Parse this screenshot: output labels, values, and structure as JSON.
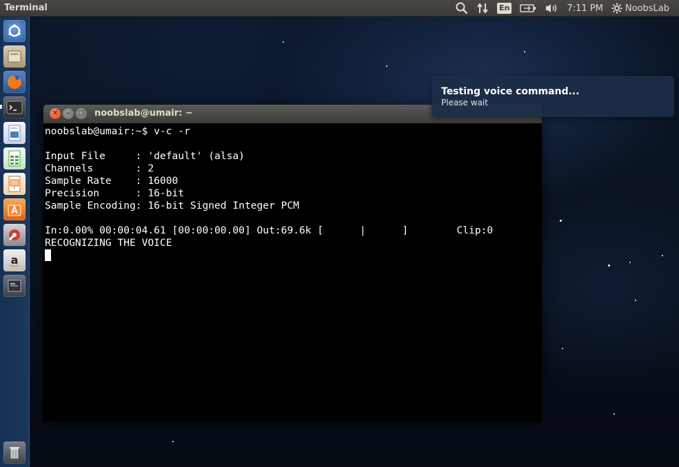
{
  "panel": {
    "app_title": "Terminal",
    "keyboard_layout": "En",
    "clock": "7:11 PM",
    "user": "NoobsLab",
    "icons": [
      "search-icon",
      "network-arrows-icon",
      "keyboard-layout-icon",
      "battery-icon",
      "volume-icon",
      "gear-icon"
    ]
  },
  "launcher": {
    "items": [
      {
        "name": "ubuntu-dash-icon",
        "color": "#3b6db0"
      },
      {
        "name": "files-icon",
        "color": "#b9a684"
      },
      {
        "name": "firefox-icon",
        "color": "#e36b1a"
      },
      {
        "name": "terminal-icon",
        "color": "#2e2e2e"
      },
      {
        "name": "writer-icon",
        "color": "#4a7fc1"
      },
      {
        "name": "calc-icon",
        "color": "#47a447"
      },
      {
        "name": "impress-icon",
        "color": "#d9782f"
      },
      {
        "name": "software-center-icon",
        "color": "#e8731f"
      },
      {
        "name": "system-settings-icon",
        "color": "#c8433a"
      },
      {
        "name": "amazon-icon",
        "color": "#2c2c2c"
      },
      {
        "name": "workspace-switcher-icon",
        "color": "#555a63"
      },
      {
        "name": "trash-icon",
        "color": "#4b4f57"
      }
    ]
  },
  "terminal": {
    "title": "noobslab@umair: ~",
    "lines": [
      "noobslab@umair:~$ v-c -r",
      "",
      "Input File     : 'default' (alsa)",
      "Channels       : 2",
      "Sample Rate    : 16000",
      "Precision      : 16-bit",
      "Sample Encoding: 16-bit Signed Integer PCM",
      "",
      "In:0.00% 00:00:04.61 [00:00:00.00] Out:69.6k [      |      ]        Clip:0",
      "RECOGNIZING THE VOICE"
    ]
  },
  "notification": {
    "title": "Testing voice command...",
    "body": "Please wait"
  }
}
